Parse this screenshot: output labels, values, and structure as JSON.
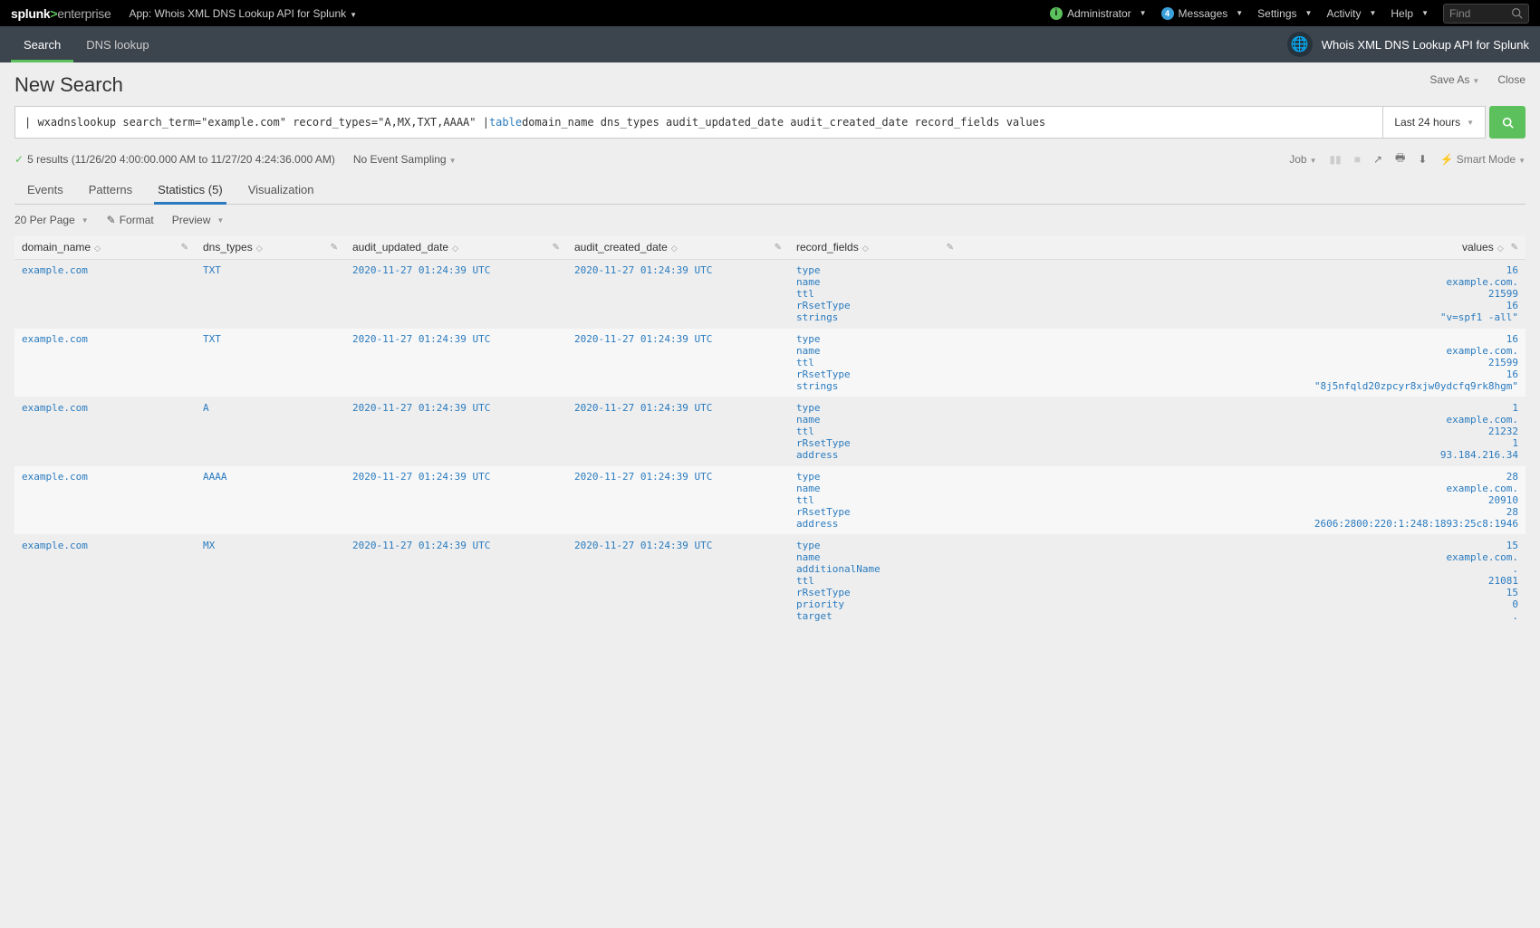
{
  "topbar": {
    "logo1": "splunk",
    "logo2": "enterprise",
    "app_label": "App: Whois XML DNS Lookup API for Splunk",
    "administrator": "Administrator",
    "messages": "Messages",
    "messages_count": "4",
    "settings": "Settings",
    "activity": "Activity",
    "help": "Help",
    "find_placeholder": "Find"
  },
  "navbar": {
    "tab_search": "Search",
    "tab_dns": "DNS lookup",
    "app_title": "Whois XML DNS Lookup API for Splunk"
  },
  "page": {
    "title": "New Search",
    "save_as": "Save As",
    "close": "Close",
    "search_plain_pre": "| wxadnslookup search_term=\"example.com\" record_types=\"A,MX,TXT,AAAA\" | ",
    "search_kw": "table",
    "search_plain_post": " domain_name dns_types audit_updated_date audit_created_date record_fields values",
    "timerange": "Last 24 hours",
    "results_count": "5 results (11/26/20 4:00:00.000 AM to 11/27/20 4:24:36.000 AM)",
    "no_sampling": "No Event Sampling",
    "job": "Job",
    "smart_mode": "Smart Mode"
  },
  "viewtabs": {
    "events": "Events",
    "patterns": "Patterns",
    "statistics": "Statistics (5)",
    "visualization": "Visualization"
  },
  "tablectrls": {
    "perpage": "20 Per Page",
    "format": "Format",
    "preview": "Preview"
  },
  "columns": {
    "domain_name": "domain_name",
    "dns_types": "dns_types",
    "audit_updated_date": "audit_updated_date",
    "audit_created_date": "audit_created_date",
    "record_fields": "record_fields",
    "values": "values"
  },
  "rows": [
    {
      "domain_name": "example.com",
      "dns_types": "TXT",
      "audit_updated_date": "2020-11-27 01:24:39 UTC",
      "audit_created_date": "2020-11-27 01:24:39 UTC",
      "fields": [
        "type",
        "name",
        "ttl",
        "rRsetType",
        "strings"
      ],
      "values": [
        "16",
        "example.com.",
        "21599",
        "16",
        "\"v=spf1 -all\""
      ]
    },
    {
      "domain_name": "example.com",
      "dns_types": "TXT",
      "audit_updated_date": "2020-11-27 01:24:39 UTC",
      "audit_created_date": "2020-11-27 01:24:39 UTC",
      "fields": [
        "type",
        "name",
        "ttl",
        "rRsetType",
        "strings"
      ],
      "values": [
        "16",
        "example.com.",
        "21599",
        "16",
        "\"8j5nfqld20zpcyr8xjw0ydcfq9rk8hgm\""
      ]
    },
    {
      "domain_name": "example.com",
      "dns_types": "A",
      "audit_updated_date": "2020-11-27 01:24:39 UTC",
      "audit_created_date": "2020-11-27 01:24:39 UTC",
      "fields": [
        "type",
        "name",
        "ttl",
        "rRsetType",
        "address"
      ],
      "values": [
        "1",
        "example.com.",
        "21232",
        "1",
        "93.184.216.34"
      ]
    },
    {
      "domain_name": "example.com",
      "dns_types": "AAAA",
      "audit_updated_date": "2020-11-27 01:24:39 UTC",
      "audit_created_date": "2020-11-27 01:24:39 UTC",
      "fields": [
        "type",
        "name",
        "ttl",
        "rRsetType",
        "address"
      ],
      "values": [
        "28",
        "example.com.",
        "20910",
        "28",
        "2606:2800:220:1:248:1893:25c8:1946"
      ]
    },
    {
      "domain_name": "example.com",
      "dns_types": "MX",
      "audit_updated_date": "2020-11-27 01:24:39 UTC",
      "audit_created_date": "2020-11-27 01:24:39 UTC",
      "fields": [
        "type",
        "name",
        "additionalName",
        "ttl",
        "rRsetType",
        "priority",
        "target"
      ],
      "values": [
        "15",
        "example.com.",
        ".",
        "21081",
        "15",
        "0",
        "."
      ]
    }
  ]
}
